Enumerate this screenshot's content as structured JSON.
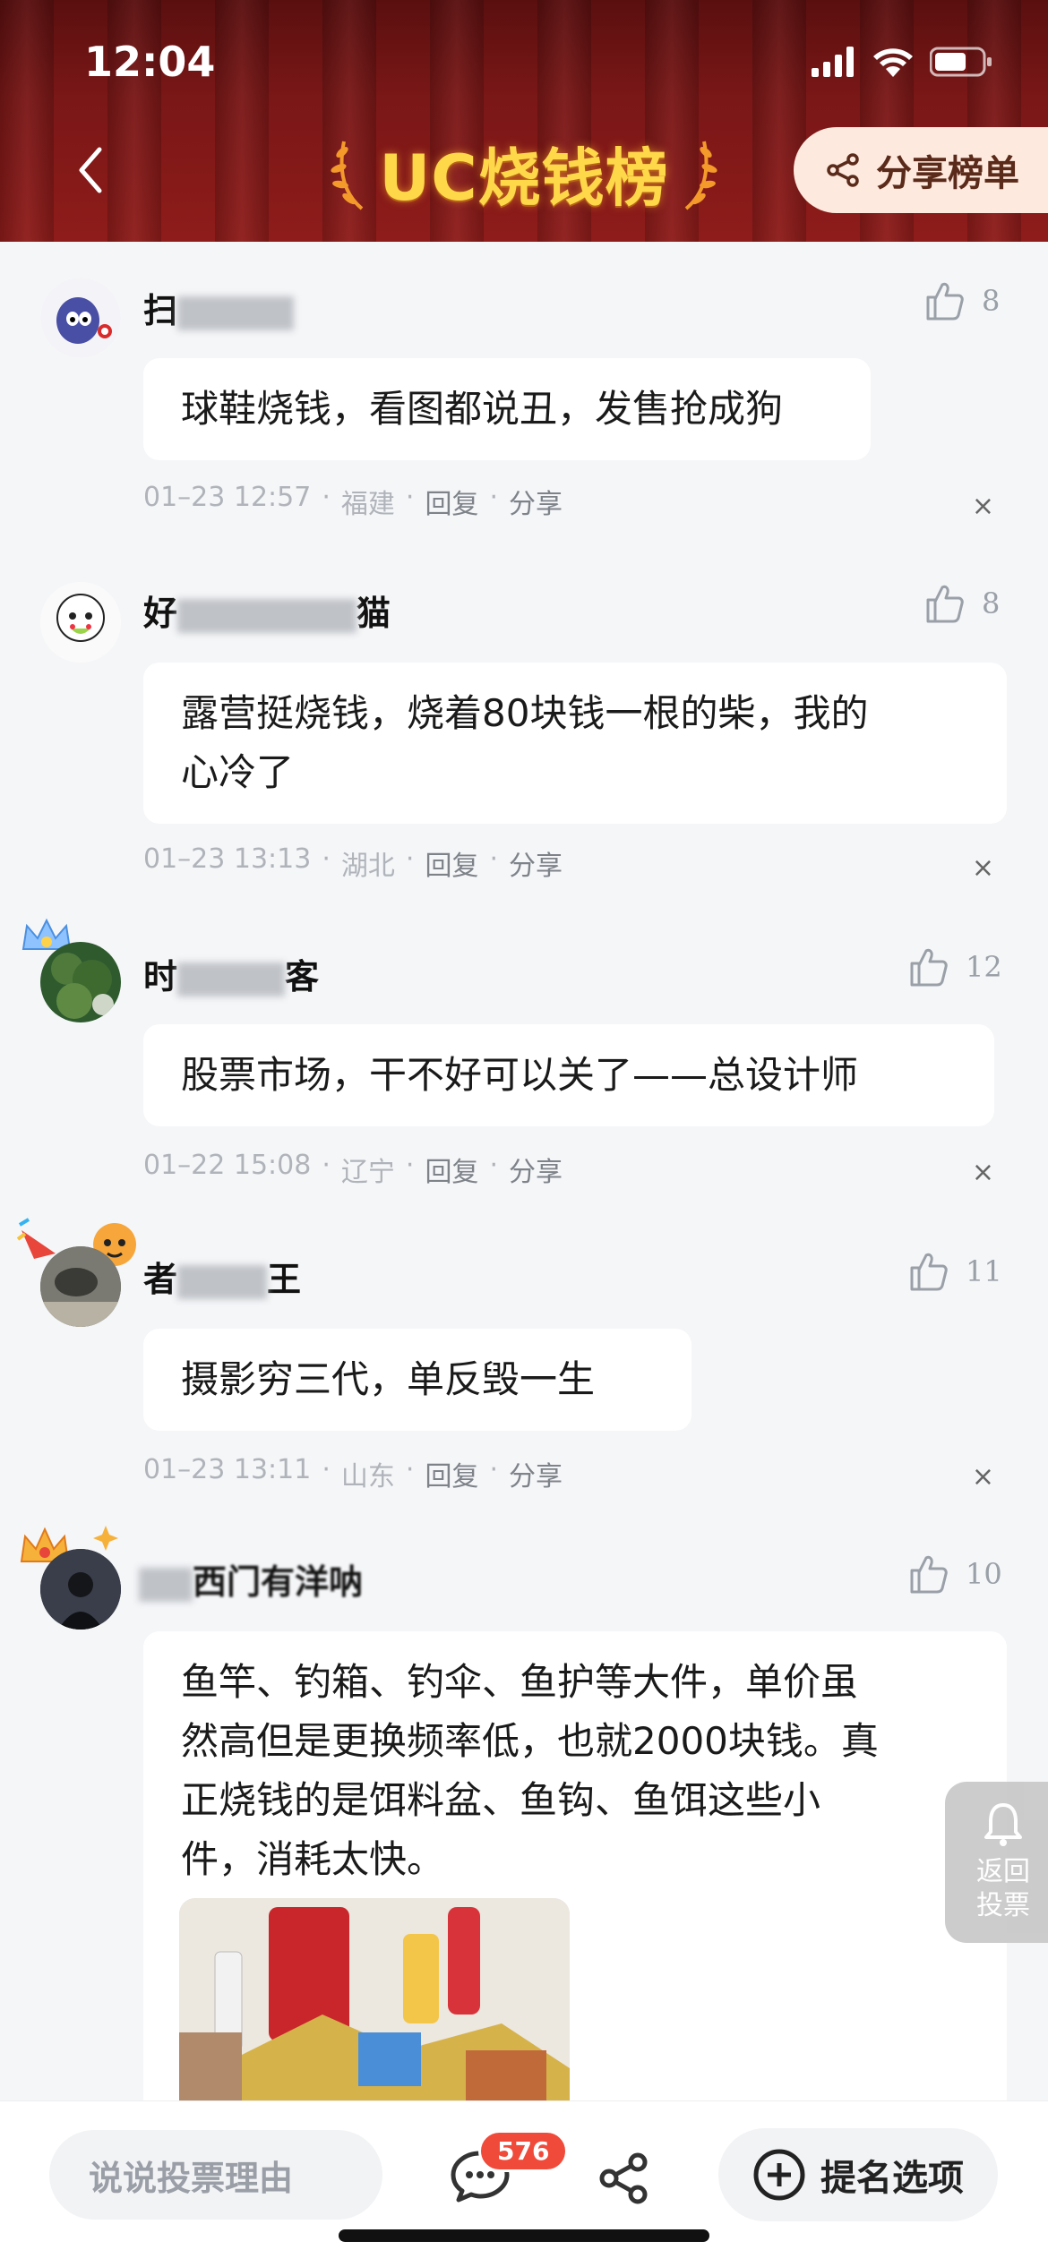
{
  "status_bar": {
    "time": "12:04"
  },
  "header": {
    "title": "UC烧钱榜",
    "share_label": "分享榜单"
  },
  "comments": [
    {
      "name_visible_first": "扫",
      "name_visible_last": "",
      "likes": "8",
      "text": "球鞋烧钱，看图都说丑，发售抢成狗",
      "date": "01–23 12:57",
      "region": "福建",
      "reply": "回复",
      "share": "分享"
    },
    {
      "name_visible_first": "好",
      "name_visible_last": "猫",
      "likes": "8",
      "text_lines": [
        "露营挺烧钱，烧着80块钱一根的柴，我的",
        "心冷了"
      ],
      "date": "01–23 13:13",
      "region": "湖北",
      "reply": "回复",
      "share": "分享"
    },
    {
      "name_visible_first": "时",
      "name_visible_last": "客",
      "likes": "12",
      "text": "股票市场，干不好可以关了——总设计师",
      "date": "01–22 15:08",
      "region": "辽宁",
      "reply": "回复",
      "share": "分享"
    },
    {
      "name_visible_first": "者",
      "name_visible_last": "王",
      "likes": "11",
      "text": "摄影穷三代，单反毁一生",
      "date": "01–23 13:11",
      "region": "山东",
      "reply": "回复",
      "share": "分享"
    },
    {
      "name_visible_first": "",
      "name_visible_last": "西门有洋呐",
      "likes": "10",
      "text_lines": [
        "鱼竿、钓箱、钓伞、鱼护等大件，单价虽",
        "然高但是更换频率低，也就2000块钱。真",
        "正烧钱的是饵料盆、鱼钩、鱼饵这些小",
        "件，消耗太快。"
      ]
    }
  ],
  "close_symbol": "×",
  "floating": {
    "return_line1": "返回",
    "return_line2": "投票"
  },
  "bottom": {
    "reason_placeholder": "说说投票理由",
    "comment_count": "576",
    "nominate_label": "提名选项"
  }
}
